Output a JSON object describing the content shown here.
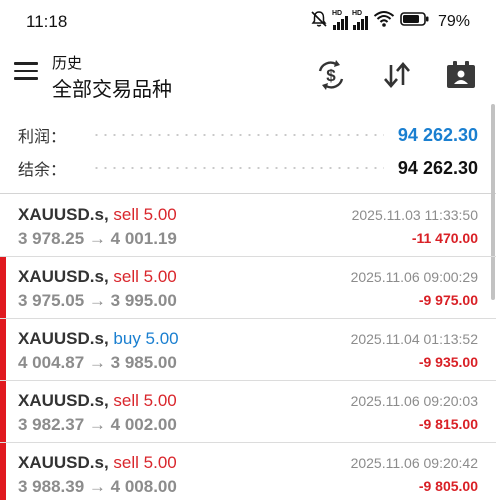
{
  "status_bar": {
    "time": "11:18",
    "battery_percent": "79%",
    "signal_labels": [
      "HD",
      "HD"
    ]
  },
  "header": {
    "subtitle": "历史",
    "title": "全部交易品种",
    "icons": [
      "menu-icon",
      "dollar-refresh-icon",
      "sort-icon",
      "calendar-person-icon"
    ]
  },
  "summary": {
    "profit_label": "利润：",
    "profit_value": "94 262.30",
    "balance_label": "结余：",
    "balance_value": "94 262.30"
  },
  "colors": {
    "profit_blue": "#1a7fd0",
    "loss_red": "#d92026",
    "sell_red": "#d9262c",
    "buy_blue": "#1a7fd0",
    "marker_red": "#e0191f"
  },
  "trades": [
    {
      "symbol": "XAUUSD.s,",
      "side": "sell 5.00",
      "side_type": "sell",
      "open_price": "3 978.25",
      "close_price": "4 001.19",
      "time": "2025.11.03 11:33:50",
      "profit": "-11 470.00",
      "marker": false
    },
    {
      "symbol": "XAUUSD.s,",
      "side": "sell 5.00",
      "side_type": "sell",
      "open_price": "3 975.05",
      "close_price": "3 995.00",
      "time": "2025.11.06 09:00:29",
      "profit": "-9 975.00",
      "marker": true
    },
    {
      "symbol": "XAUUSD.s,",
      "side": "buy 5.00",
      "side_type": "buy",
      "open_price": "4 004.87",
      "close_price": "3 985.00",
      "time": "2025.11.04 01:13:52",
      "profit": "-9 935.00",
      "marker": true
    },
    {
      "symbol": "XAUUSD.s,",
      "side": "sell 5.00",
      "side_type": "sell",
      "open_price": "3 982.37",
      "close_price": "4 002.00",
      "time": "2025.11.06 09:20:03",
      "profit": "-9 815.00",
      "marker": true
    },
    {
      "symbol": "XAUUSD.s,",
      "side": "sell 5.00",
      "side_type": "sell",
      "open_price": "3 988.39",
      "close_price": "4 008.00",
      "time": "2025.11.06 09:20:42",
      "profit": "-9 805.00",
      "marker": true
    }
  ],
  "arrow": "→"
}
